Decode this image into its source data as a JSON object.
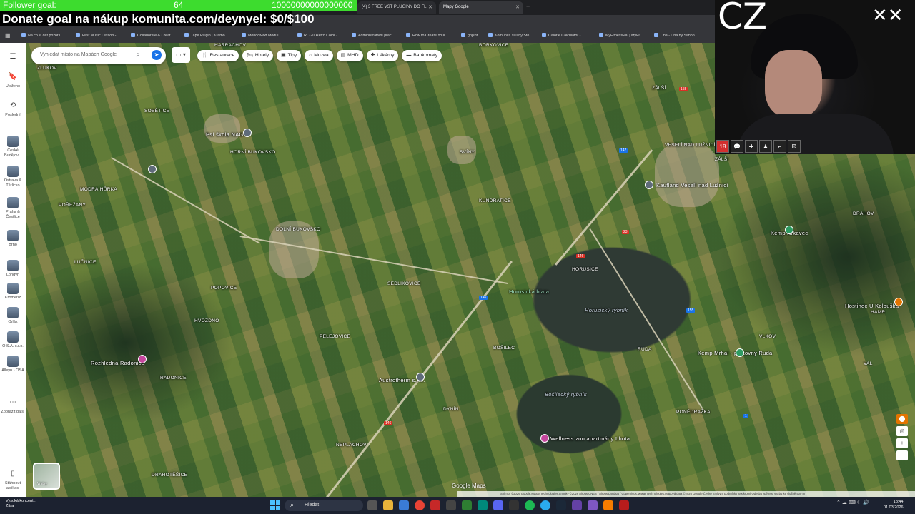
{
  "overlay": {
    "follower_label": "Follower goal:",
    "follower_count": "64",
    "follower_target": "10000000000000000",
    "donate_text": "Donate goal na nákup komunita.com/deynyel: $0/$100",
    "cam_text": "CZ"
  },
  "browser": {
    "tabs": [
      {
        "label": "(4) 3 FREE VST PLUGINY DO FL"
      },
      {
        "label": "Mapy Google"
      }
    ],
    "url": "...g.cdn-3bing.vb3-1.&AFU...hzwlkXMDSoASAFQAw%3D%3D",
    "bookmarks": [
      "Na co si dát pozor u...",
      "First Music Lesson -...",
      "Collaborate & Creat...",
      "Tape Plugin | Kramo...",
      "MondoMod Modul...",
      "RC-20 Retro Color -...",
      "Administrativní prac...",
      "How to Create Your...",
      "ghjshf",
      "Komunita služby Ste...",
      "Calorie Calculator -...",
      "MyFitnessPal | MyFit...",
      "Cha - Cha by Simon..."
    ]
  },
  "maps": {
    "search_placeholder": "Vyhledat místo na Mapách Google",
    "chips": [
      {
        "label": "Restaurace",
        "icon": "fork-knife-icon"
      },
      {
        "label": "Hotely",
        "icon": "bed-icon"
      },
      {
        "label": "Tipy",
        "icon": "camera-icon"
      },
      {
        "label": "Muzea",
        "icon": "museum-icon"
      },
      {
        "label": "MHD",
        "icon": "bus-icon"
      },
      {
        "label": "Lékárny",
        "icon": "pharmacy-icon"
      },
      {
        "label": "Bankomaty",
        "icon": "atm-icon"
      }
    ],
    "rail": [
      {
        "label": "Uloženo",
        "icon": "bookmark-icon"
      },
      {
        "label": "Poslední",
        "icon": "history-icon"
      },
      {
        "label": "České Budějov...",
        "icon": "photo"
      },
      {
        "label": "Ostrava & Těrlicko",
        "icon": "photo"
      },
      {
        "label": "Praha & Čestlice",
        "icon": "photo"
      },
      {
        "label": "Brno",
        "icon": "photo"
      },
      {
        "label": "Londýn",
        "icon": "photo"
      },
      {
        "label": "Kroměříž",
        "icon": "photo"
      },
      {
        "label": "Orlák",
        "icon": "photo"
      },
      {
        "label": "O.S.A. s.r.o.",
        "icon": "photo"
      },
      {
        "label": "Alleyn - OSA",
        "icon": "photo"
      },
      {
        "label": "Zobrazit další",
        "icon": "more-icon"
      },
      {
        "label": "Stáhnout aplikaci",
        "icon": "phone-icon"
      }
    ],
    "layer_label": "Vrstvy",
    "logo": "Google Maps",
    "footer": "Snímky ©2026 Google,Maxar Technologies,Snímky ©2026 Airbus,CNES / Airbus,Landsat / Copernicus,Maxar Technologies,Mapová data ©2026 Google   Česko   Smluvní podmínky   Soukromí   Odeslat zpětnou vazbu ke službě   500 m",
    "places": [
      {
        "name": "Harrachov",
        "kind": "town"
      },
      {
        "name": "Borkovice",
        "kind": "town"
      },
      {
        "name": "Zlukov",
        "kind": "town"
      },
      {
        "name": "Zálší",
        "kind": "town"
      },
      {
        "name": "Sobětice",
        "kind": "town"
      },
      {
        "name": "Psí škola NAGIT",
        "kind": "poi"
      },
      {
        "name": "Horní Bukovsko",
        "kind": "town"
      },
      {
        "name": "Svíny",
        "kind": "town"
      },
      {
        "name": "Veselí nad Lužnicí",
        "kind": "town"
      },
      {
        "name": "Zálší",
        "kind": "town"
      },
      {
        "name": "Modrá Hůrka",
        "kind": "town"
      },
      {
        "name": "Kaufland Veselí nad Lužnicí",
        "kind": "poi"
      },
      {
        "name": "Kundratice",
        "kind": "town"
      },
      {
        "name": "Drahov",
        "kind": "town"
      },
      {
        "name": "Pořežany",
        "kind": "town"
      },
      {
        "name": "Dolní Bukovsko",
        "kind": "town"
      },
      {
        "name": "Kemp Krkavec",
        "kind": "poi"
      },
      {
        "name": "Horusice",
        "kind": "town"
      },
      {
        "name": "Lučnice",
        "kind": "town"
      },
      {
        "name": "Sedlikovice",
        "kind": "town"
      },
      {
        "name": "Horusická blata",
        "kind": "area"
      },
      {
        "name": "Horusický rybník",
        "kind": "lake"
      },
      {
        "name": "Popovice",
        "kind": "town"
      },
      {
        "name": "Hostinec U Kolouška",
        "kind": "poi"
      },
      {
        "name": "Hvozdno",
        "kind": "town"
      },
      {
        "name": "Vlkov",
        "kind": "town"
      },
      {
        "name": "Pelejovice",
        "kind": "town"
      },
      {
        "name": "Bošilec",
        "kind": "town"
      },
      {
        "name": "Ruda",
        "kind": "town"
      },
      {
        "name": "Kemp Mrhal - pískovny Ruda",
        "kind": "poi"
      },
      {
        "name": "Rozhledna Radonice",
        "kind": "poi"
      },
      {
        "name": "Austrotherm s.r.o.",
        "kind": "poi"
      },
      {
        "name": "Val",
        "kind": "town"
      },
      {
        "name": "Radonice",
        "kind": "town"
      },
      {
        "name": "Bošilecký rybník",
        "kind": "lake"
      },
      {
        "name": "Dynín",
        "kind": "town"
      },
      {
        "name": "Ponědražka",
        "kind": "town"
      },
      {
        "name": "Wellness zoo apartmány Lhota",
        "kind": "poi"
      },
      {
        "name": "Neplachov",
        "kind": "town"
      },
      {
        "name": "Drahotěšice",
        "kind": "town"
      },
      {
        "name": "Hamr",
        "kind": "town"
      }
    ],
    "road_signs": [
      "155",
      "147",
      "23",
      "146",
      "146",
      "155",
      "146",
      "1"
    ]
  },
  "taskbar": {
    "weather_line1": "Vysoká koncent...",
    "weather_line2": "Zítra",
    "search_label": "Hledat",
    "time": "18:44",
    "date": "01.03.2026"
  }
}
